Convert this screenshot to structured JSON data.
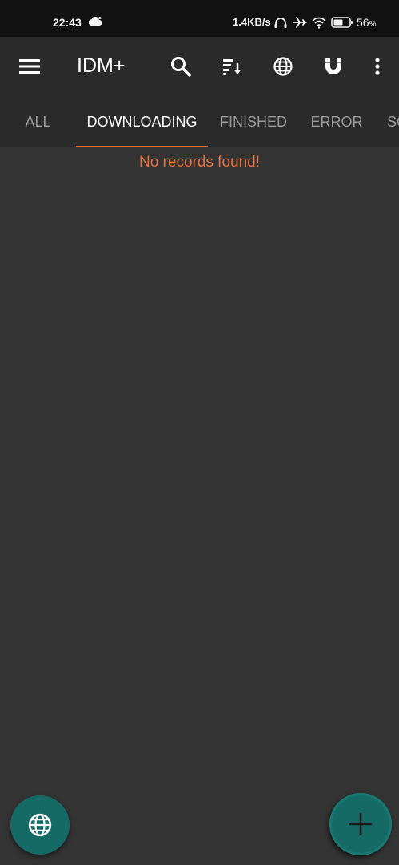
{
  "status_bar": {
    "time": "22:43",
    "net_speed": "1.4KB/s",
    "battery_percent": "56",
    "battery_symbol": "%",
    "icons": [
      "cloud-icon",
      "headphones-icon",
      "airplane-icon",
      "wifi-icon",
      "battery-icon"
    ]
  },
  "app_bar": {
    "title": "IDM+",
    "icons": [
      "menu-icon",
      "search-icon",
      "sort-icon",
      "globe-icon",
      "magnet-icon",
      "more-vertical-icon"
    ]
  },
  "tabs": [
    {
      "label": "ALL",
      "active": false
    },
    {
      "label": "DOWNLOADING",
      "active": true
    },
    {
      "label": "FINISHED",
      "active": false
    },
    {
      "label": "ERROR",
      "active": false
    },
    {
      "label": "SC",
      "active": false
    }
  ],
  "content": {
    "empty_message": "No records found!"
  },
  "fabs": {
    "browser_icon": "globe-icon",
    "add_icon": "plus-icon"
  },
  "colors": {
    "background": "#333333",
    "app_bar": "#2a2a2a",
    "status_bar": "#111111",
    "accent": "#e06b3a",
    "fab": "#156a66",
    "tab_active": "#ffffff",
    "tab_inactive": "#9a9a9a"
  }
}
